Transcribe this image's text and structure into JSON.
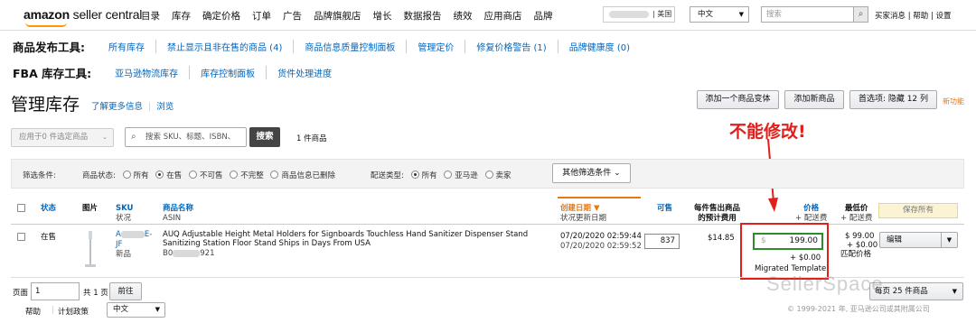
{
  "topnav": {
    "logo_brand": "amazon",
    "logo_suffix": "seller central",
    "menu": [
      "目录",
      "库存",
      "确定价格",
      "订单",
      "广告",
      "品牌旗舰店",
      "增长",
      "数据报告",
      "绩效",
      "应用商店",
      "品牌"
    ],
    "marketplace": "| 美国",
    "language": "中文",
    "search_placeholder": "搜索",
    "links": "买家消息 | 帮助 | 设置"
  },
  "tools": {
    "publish_title": "商品发布工具:",
    "publish_items": [
      "所有库存",
      "禁止显示且非在售的商品 (4)",
      "商品信息质量控制面板",
      "管理定价",
      "修复价格警告 (1)",
      "品牌健康度 (0)"
    ],
    "fba_title": "FBA 库存工具:",
    "fba_items": [
      "亚马逊物流库存",
      "库存控制面板",
      "货件处理进度"
    ]
  },
  "page": {
    "title": "管理库存",
    "learn_more": "了解更多信息",
    "browse": "浏览",
    "add_variant": "添加一个商品变体",
    "add_product": "添加新商品",
    "preferences": "首选项: 隐藏 12 列",
    "new_feature": "新功能"
  },
  "actions": {
    "apply_to": "应用于0 件选定商品",
    "sku_search_placeholder": "搜索 SKU、标题、ISBN、",
    "search_button": "搜索",
    "item_count": "1 件商品"
  },
  "filters": {
    "label": "筛选条件:",
    "status_label": "商品状态:",
    "status_options": [
      "所有",
      "在售",
      "不可售",
      "不完整",
      "商品信息已删除"
    ],
    "status_selected": 1,
    "fulfillment_label": "配送类型:",
    "fulfillment_options": [
      "所有",
      "亚马逊",
      "卖家"
    ],
    "fulfillment_selected": 0,
    "other_filters": "其他筛选条件"
  },
  "annotation": "不能修改!",
  "table": {
    "headers": {
      "status": "状态",
      "image": "图片",
      "sku": "SKU",
      "sku_sub": "状况",
      "name": "商品名称",
      "name_sub": "ASIN",
      "created": "创建日期 ▼",
      "created_sub": "状况更新日期",
      "available": "可售",
      "fee_line1": "每件售出商品",
      "fee_line2": "的预计费用",
      "price": "价格",
      "price_sub": "+ 配送费",
      "lowest": "最低价",
      "lowest_sub": "+ 配送费",
      "save_all": "保存所有"
    },
    "rows": [
      {
        "status": "在售",
        "sku_a": "A",
        "sku_b": "E-",
        "sku_c": "JF",
        "condition": "新品",
        "title": "AUQ Adjustable Height Metal Holders for Signboards Touchless Hand Sanitizer Dispenser Stand Sanitizing Station Floor Stand Ships in Days From USA",
        "asin_prefix": "B0",
        "asin_suffix": "921",
        "created": "07/20/2020 02:59:44",
        "updated": "07/20/2020 02:59:52",
        "available": "837",
        "fee": "$14.85",
        "price_currency": "$",
        "price": "199.00",
        "shipping": "+ $0.00",
        "template": "Migrated Template",
        "lowest": "$ 99.00",
        "lowest_shipping": "+ $0.00",
        "match_price": "匹配价格",
        "edit": "编辑"
      }
    ]
  },
  "pagination": {
    "page_label": "页面",
    "page_value": "1",
    "total": "共 1 页",
    "go": "前往",
    "per_page": "每页 25 件商品"
  },
  "footer": {
    "help": "帮助",
    "policy": "计划政策",
    "language": "中文",
    "copyright": "© 1999-2021 年, 亚马逊公司或其附属公司",
    "watermark": "SellerSpace"
  }
}
